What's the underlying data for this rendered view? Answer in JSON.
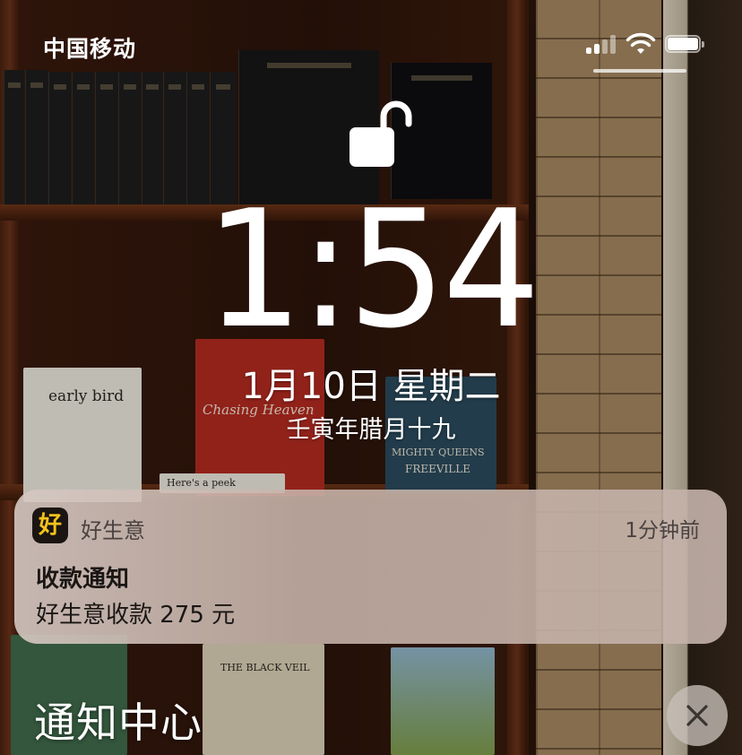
{
  "status_bar": {
    "carrier": "中国移动",
    "signal_icon": "cellular-signal-icon",
    "wifi_icon": "wifi-icon",
    "battery_icon": "battery-icon",
    "battery_level": 0.9
  },
  "lock_screen": {
    "lock_icon": "unlocked-padlock-icon",
    "time": "1:54",
    "date": "1月10日 星期二",
    "lunar_date": "壬寅年腊月十九"
  },
  "notification": {
    "app_icon_glyph": "好",
    "app_name": "好生意",
    "time_ago": "1分钟前",
    "title": "收款通知",
    "body": "好生意收款 275 元"
  },
  "notification_center": {
    "title": "通知中心",
    "clear_icon": "close-icon"
  },
  "background_text": {
    "book1": "early bird",
    "book2": "Chasing Heaven",
    "book3": "MIGHTY QUEENS",
    "book3b": "FREEVILLE",
    "book4": "THE BLACK VEIL",
    "note": "Here's a peek"
  },
  "colors": {
    "app_icon_bg": "#1a1512",
    "app_icon_glyph": "#f3c21b",
    "card_bg": "#d0bdb4"
  }
}
